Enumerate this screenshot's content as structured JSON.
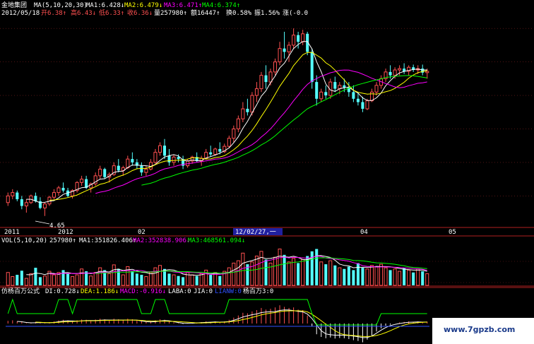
{
  "header": {
    "stock_name": "金地集团",
    "ma_label": "MA(5,10,20,30)",
    "ma1": "MA1:6.428↓",
    "ma2": "MA2:6.479↓",
    "ma3": "MA3:6.471↑",
    "ma4": "MA4:6.374↑",
    "date": "2012/05/18",
    "open": "开6.38↑",
    "high": "高6.43↓",
    "low": "低6.33↑",
    "close": "收6.36↓",
    "volume": "量257980↑",
    "amount": "额16447↑",
    "turnover": "换0.58%",
    "amplitude": "振1.56%",
    "change": "涨(-0.0"
  },
  "price_panel": {
    "low_marker": "4.65"
  },
  "date_axis": {
    "labels": [
      "2011",
      "2012",
      "02",
      "12/02/27,一",
      "04",
      "05"
    ]
  },
  "volume_header": {
    "label": "VOL(5,10,20)",
    "vol": "257980↑",
    "ma1": "MA1:351826.406↑",
    "ma2": "MA2:352838.906↓",
    "ma3": "MA3:468561.094↓"
  },
  "indicator_header": {
    "label": "仿杨百万公式",
    "di": "DI:0.728↓",
    "dea": "DEA:1.186↓",
    "macd": "MACD:-0.916↓",
    "laba": "LABA:0",
    "jia": "JIA:0",
    "lianw": "LIANW:0",
    "ybw": "杨百万3:0"
  },
  "watermark": "www.7gpzb.com",
  "colors": {
    "background": "#000000",
    "up": "#ff5050",
    "down": "#54ffff",
    "ma1": "#ffffff",
    "ma2": "#ffff00",
    "ma3": "#ff00ff",
    "ma4": "#00ff00",
    "axis": "#b02020"
  },
  "chart_data": {
    "type": "candlestick",
    "candles": [
      [
        4.9,
        5.05,
        4.85,
        5.0
      ],
      [
        5.0,
        5.1,
        4.95,
        5.05
      ],
      [
        5.05,
        5.08,
        4.92,
        4.95
      ],
      [
        4.95,
        5.0,
        4.8,
        4.85
      ],
      [
        4.85,
        4.95,
        4.75,
        4.9
      ],
      [
        4.9,
        5.02,
        4.88,
        5.0
      ],
      [
        5.0,
        5.05,
        4.9,
        4.92
      ],
      [
        4.92,
        4.98,
        4.8,
        4.82
      ],
      [
        4.82,
        4.9,
        4.7,
        4.88
      ],
      [
        4.88,
        5.0,
        4.85,
        4.98
      ],
      [
        4.98,
        5.1,
        4.95,
        5.05
      ],
      [
        5.05,
        5.15,
        5.0,
        5.12
      ],
      [
        5.12,
        5.2,
        5.05,
        5.08
      ],
      [
        5.08,
        5.12,
        4.98,
        5.0
      ],
      [
        5.0,
        5.1,
        4.96,
        5.08
      ],
      [
        5.08,
        5.22,
        5.05,
        5.2
      ],
      [
        5.2,
        5.3,
        5.15,
        5.25
      ],
      [
        5.25,
        5.3,
        5.1,
        5.12
      ],
      [
        5.12,
        5.2,
        5.05,
        5.18
      ],
      [
        5.18,
        5.35,
        5.15,
        5.3
      ],
      [
        5.3,
        5.45,
        5.25,
        5.4
      ],
      [
        5.4,
        5.42,
        5.25,
        5.28
      ],
      [
        5.28,
        5.35,
        5.2,
        5.32
      ],
      [
        5.32,
        5.5,
        5.3,
        5.45
      ],
      [
        5.45,
        5.55,
        5.35,
        5.38
      ],
      [
        5.38,
        5.45,
        5.3,
        5.42
      ],
      [
        5.42,
        5.6,
        5.4,
        5.55
      ],
      [
        5.55,
        5.65,
        5.45,
        5.5
      ],
      [
        5.5,
        5.55,
        5.4,
        5.45
      ],
      [
        5.45,
        5.5,
        5.3,
        5.35
      ],
      [
        5.35,
        5.45,
        5.3,
        5.4
      ],
      [
        5.4,
        5.55,
        5.38,
        5.5
      ],
      [
        5.5,
        5.7,
        5.48,
        5.65
      ],
      [
        5.65,
        5.8,
        5.6,
        5.75
      ],
      [
        5.75,
        5.85,
        5.55,
        5.6
      ],
      [
        5.6,
        5.7,
        5.45,
        5.5
      ],
      [
        5.5,
        5.62,
        5.45,
        5.58
      ],
      [
        5.58,
        5.62,
        5.5,
        5.55
      ],
      [
        5.55,
        5.6,
        5.4,
        5.45
      ],
      [
        5.45,
        5.55,
        5.42,
        5.52
      ],
      [
        5.52,
        5.6,
        5.48,
        5.58
      ],
      [
        5.58,
        5.65,
        5.5,
        5.52
      ],
      [
        5.52,
        5.6,
        5.45,
        5.56
      ],
      [
        5.56,
        5.7,
        5.54,
        5.65
      ],
      [
        5.65,
        5.75,
        5.58,
        5.62
      ],
      [
        5.62,
        5.72,
        5.6,
        5.7
      ],
      [
        5.7,
        5.8,
        5.62,
        5.66
      ],
      [
        5.66,
        5.78,
        5.64,
        5.74
      ],
      [
        5.74,
        5.9,
        5.72,
        5.86
      ],
      [
        5.86,
        6.05,
        5.8,
        6.0
      ],
      [
        6.0,
        6.2,
        5.95,
        6.15
      ],
      [
        6.15,
        6.4,
        6.1,
        6.3
      ],
      [
        6.3,
        6.45,
        6.2,
        6.25
      ],
      [
        6.25,
        6.55,
        6.2,
        6.5
      ],
      [
        6.5,
        6.7,
        6.4,
        6.6
      ],
      [
        6.6,
        6.85,
        6.55,
        6.8
      ],
      [
        6.8,
        6.95,
        6.6,
        6.7
      ],
      [
        6.7,
        6.9,
        6.65,
        6.85
      ],
      [
        6.85,
        7.05,
        6.8,
        7.0
      ],
      [
        7.0,
        7.3,
        6.95,
        7.2
      ],
      [
        7.2,
        7.45,
        7.05,
        7.15
      ],
      [
        7.15,
        7.3,
        7.0,
        7.25
      ],
      [
        7.25,
        7.5,
        7.2,
        7.4
      ],
      [
        7.4,
        7.45,
        7.2,
        7.3
      ],
      [
        7.3,
        7.48,
        7.25,
        7.42
      ],
      [
        7.42,
        7.45,
        7.1,
        7.15
      ],
      [
        7.15,
        7.2,
        6.6,
        6.7
      ],
      [
        6.7,
        6.8,
        6.35,
        6.45
      ],
      [
        6.45,
        6.6,
        6.4,
        6.55
      ],
      [
        6.55,
        6.65,
        6.45,
        6.5
      ],
      [
        6.5,
        6.75,
        6.45,
        6.7
      ],
      [
        6.7,
        6.78,
        6.55,
        6.6
      ],
      [
        6.6,
        6.7,
        6.52,
        6.65
      ],
      [
        6.65,
        6.75,
        6.55,
        6.62
      ],
      [
        6.62,
        6.7,
        6.48,
        6.55
      ],
      [
        6.55,
        6.65,
        6.4,
        6.45
      ],
      [
        6.45,
        6.55,
        6.35,
        6.4
      ],
      [
        6.4,
        6.48,
        6.25,
        6.3
      ],
      [
        6.3,
        6.45,
        6.28,
        6.42
      ],
      [
        6.42,
        6.6,
        6.4,
        6.55
      ],
      [
        6.55,
        6.7,
        6.5,
        6.65
      ],
      [
        6.65,
        6.8,
        6.6,
        6.75
      ],
      [
        6.75,
        6.9,
        6.7,
        6.85
      ],
      [
        6.85,
        6.95,
        6.75,
        6.8
      ],
      [
        6.8,
        6.92,
        6.75,
        6.88
      ],
      [
        6.88,
        6.95,
        6.8,
        6.9
      ],
      [
        6.9,
        6.98,
        6.82,
        6.86
      ],
      [
        6.86,
        6.95,
        6.8,
        6.92
      ],
      [
        6.92,
        6.96,
        6.85,
        6.88
      ],
      [
        6.88,
        6.95,
        6.82,
        6.9
      ],
      [
        6.9,
        6.96,
        6.8,
        6.84
      ],
      [
        6.84,
        6.9,
        6.75,
        6.86
      ]
    ],
    "ma_series": [
      {
        "name": "MA1",
        "values": [
          6.428
        ]
      },
      {
        "name": "MA2",
        "values": [
          6.479
        ]
      },
      {
        "name": "MA3",
        "values": [
          6.471
        ]
      },
      {
        "name": "MA4",
        "values": [
          6.374
        ]
      }
    ],
    "volume": [
      22,
      15,
      18,
      25,
      12,
      20,
      30,
      14,
      16,
      24,
      18,
      22,
      26,
      20,
      15,
      18,
      28,
      24,
      16,
      22,
      30,
      26,
      20,
      35,
      28,
      18,
      32,
      24,
      20,
      18,
      15,
      22,
      30,
      34,
      28,
      20,
      18,
      16,
      14,
      22,
      18,
      16,
      20,
      26,
      18,
      22,
      16,
      24,
      30,
      38,
      42,
      55,
      36,
      40,
      50,
      58,
      44,
      38,
      48,
      62,
      52,
      40,
      46,
      38,
      44,
      50,
      58,
      62,
      40,
      36,
      42,
      34,
      30,
      28,
      32,
      26,
      38,
      30,
      28,
      34,
      32,
      36,
      30,
      26,
      28,
      24,
      30,
      26,
      22,
      28,
      24,
      20
    ],
    "indicator_macd": [
      0.1,
      0.12,
      0.08,
      0.05,
      0.02,
      0.03,
      0.06,
      0.04,
      0.02,
      0.05,
      0.08,
      0.12,
      0.14,
      0.12,
      0.1,
      0.12,
      0.15,
      0.14,
      0.12,
      0.15,
      0.18,
      0.16,
      0.14,
      0.18,
      0.16,
      0.14,
      0.18,
      0.16,
      0.12,
      0.08,
      0.06,
      0.08,
      0.12,
      0.16,
      0.14,
      0.08,
      0.04,
      0.02,
      -0.02,
      0.02,
      0.04,
      0.03,
      0.05,
      0.08,
      0.06,
      0.08,
      0.06,
      0.08,
      0.14,
      0.22,
      0.3,
      0.4,
      0.38,
      0.45,
      0.5,
      0.58,
      0.52,
      0.55,
      0.6,
      0.68,
      0.62,
      0.58,
      0.6,
      0.52,
      0.5,
      0.3,
      -0.1,
      -0.4,
      -0.5,
      -0.55,
      -0.52,
      -0.56,
      -0.54,
      -0.55,
      -0.58,
      -0.62,
      -0.65,
      -0.7,
      -0.6,
      -0.45,
      -0.3,
      -0.18,
      -0.08,
      -0.04,
      0.0,
      0.04,
      0.06,
      0.08,
      0.06,
      0.08,
      0.06,
      0.07
    ]
  }
}
